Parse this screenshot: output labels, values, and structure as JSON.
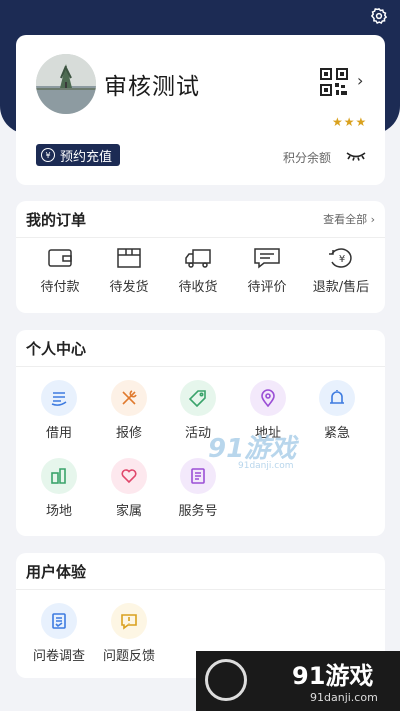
{
  "profile": {
    "username": "审核测试",
    "stars": "★★★",
    "recharge_label": "预约充值",
    "points_label": "积分余额"
  },
  "orders": {
    "title": "我的订单",
    "view_all": "查看全部",
    "items": [
      {
        "label": "待付款",
        "icon": "wallet-icon"
      },
      {
        "label": "待发货",
        "icon": "box-icon"
      },
      {
        "label": "待收货",
        "icon": "truck-icon"
      },
      {
        "label": "待评价",
        "icon": "comment-icon"
      },
      {
        "label": "退款/售后",
        "icon": "refund-icon"
      }
    ]
  },
  "personal": {
    "title": "个人中心",
    "items": [
      {
        "label": "借用",
        "icon": "borrow-icon",
        "color": "#3d7be0",
        "bg": "#e8f1fd"
      },
      {
        "label": "报修",
        "icon": "repair-icon",
        "color": "#e07a2e",
        "bg": "#fdf1e6"
      },
      {
        "label": "活动",
        "icon": "tag-icon",
        "color": "#3aa36b",
        "bg": "#e6f6ec"
      },
      {
        "label": "地址",
        "icon": "location-icon",
        "color": "#9b4fd6",
        "bg": "#f3e9fb"
      },
      {
        "label": "紧急",
        "icon": "alarm-icon",
        "color": "#3d7be0",
        "bg": "#e8f1fd"
      },
      {
        "label": "场地",
        "icon": "venue-icon",
        "color": "#3aa36b",
        "bg": "#e6f6ec"
      },
      {
        "label": "家属",
        "icon": "heart-icon",
        "color": "#e0476b",
        "bg": "#fde8ee"
      },
      {
        "label": "服务号",
        "icon": "service-icon",
        "color": "#9b4fd6",
        "bg": "#f3e9fb"
      }
    ]
  },
  "experience": {
    "title": "用户体验",
    "items": [
      {
        "label": "问卷调查",
        "icon": "survey-icon",
        "color": "#3d7be0",
        "bg": "#e8f1fd"
      },
      {
        "label": "问题反馈",
        "icon": "feedback-icon",
        "color": "#d9a11e",
        "bg": "#fdf6e4"
      }
    ]
  },
  "watermark": {
    "center_logo": "91游戏",
    "center_site": "91danji.com",
    "corner_logo": "91游戏",
    "corner_site": "91danji.com"
  }
}
